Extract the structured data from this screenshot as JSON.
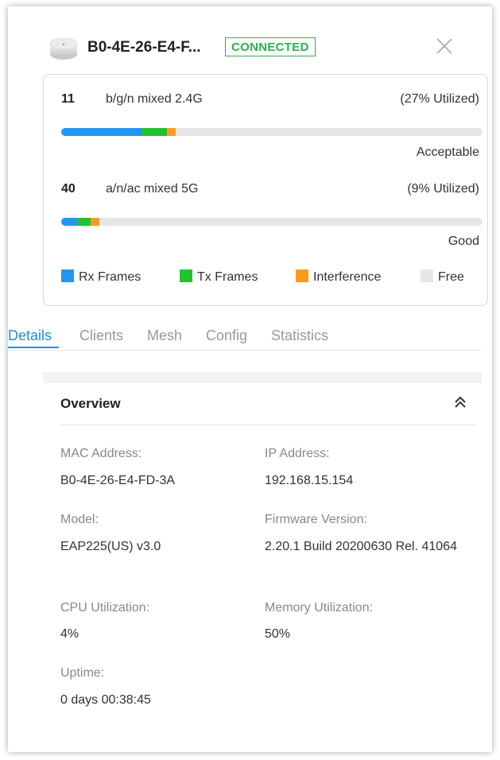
{
  "header": {
    "device_name": "B0-4E-26-E4-F...",
    "status": "CONNECTED",
    "close_icon": "close-icon"
  },
  "radios": [
    {
      "channel": "11",
      "mode": "b/g/n mixed  2.4G",
      "utilized": "(27% Utilized)",
      "status": "Acceptable",
      "rx_frames": 0.19,
      "tx_frames": 0.06,
      "interference": 0.02
    },
    {
      "channel": "40",
      "mode": "a/n/ac mixed  5G",
      "utilized": "(9% Utilized)",
      "status": "Good",
      "rx_frames": 0.04,
      "tx_frames": 0.03,
      "interference": 0.02
    }
  ],
  "legend": {
    "rx": "Rx Frames",
    "tx": "Tx Frames",
    "interference": "Interference",
    "free": "Free"
  },
  "colors": {
    "rx": "#2196f3",
    "tx": "#22c32e",
    "interference": "#ff9a1f",
    "free": "#e6e6e6",
    "connected": "#2bb24c",
    "accent": "#1e8fe0"
  },
  "tabs": [
    "Details",
    "Clients",
    "Mesh",
    "Config",
    "Statistics"
  ],
  "overview": {
    "title": "Overview",
    "mac_label": "MAC Address:",
    "mac_value": "B0-4E-26-E4-FD-3A",
    "ip_label": "IP Address:",
    "ip_value": "192.168.15.154",
    "model_label": "Model:",
    "model_value": "EAP225(US) v3.0",
    "firmware_label": "Firmware Version:",
    "firmware_value": "2.20.1 Build 20200630 Rel. 41064",
    "cpu_label": "CPU Utilization:",
    "cpu_value": "4%",
    "memory_label": "Memory Utilization:",
    "memory_value": "50%",
    "uptime_label": "Uptime:",
    "uptime_value": "0 days 00:38:45"
  }
}
